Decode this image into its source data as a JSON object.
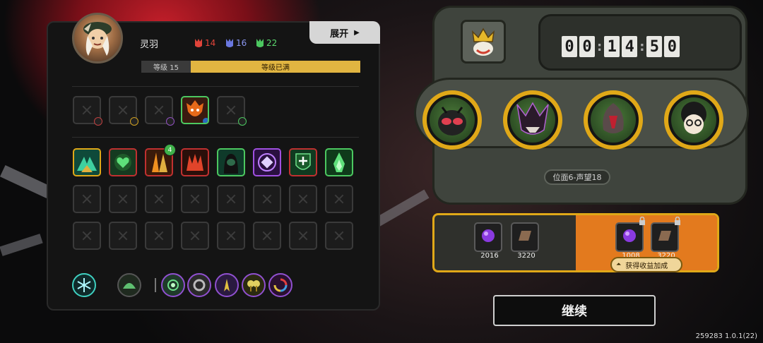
{
  "player": {
    "name": "灵羽",
    "resources": [
      {
        "icon": "red-mask-icon",
        "value": "14",
        "color": "#e0443a"
      },
      {
        "icon": "blue-mask-icon",
        "value": "16",
        "color": "#6a78e0"
      },
      {
        "icon": "green-mask-icon",
        "value": "22",
        "color": "#4cc860"
      }
    ],
    "level_label": "等级 15",
    "level_status": "等级已满",
    "expand_label": "展开",
    "skill_badge": "4"
  },
  "timer": {
    "digits": [
      "0",
      "0",
      "1",
      "4",
      "5",
      "0"
    ]
  },
  "rank_tag": "位面6-声望18",
  "rewards": {
    "base": [
      {
        "icon": "purple-orb-icon",
        "value": "2016"
      },
      {
        "icon": "brown-tile-icon",
        "value": "3220"
      }
    ],
    "locked": [
      {
        "icon": "purple-orb-icon",
        "value": "1008"
      },
      {
        "icon": "brown-tile-icon",
        "value": "3220"
      }
    ],
    "bonus_label": "获得收益加成"
  },
  "continue_label": "继续",
  "version": "259283 1.0.1(22)",
  "colors": {
    "accent": "#e0a818",
    "orange": "#e37a1e",
    "level_fill": "#e1b541"
  }
}
